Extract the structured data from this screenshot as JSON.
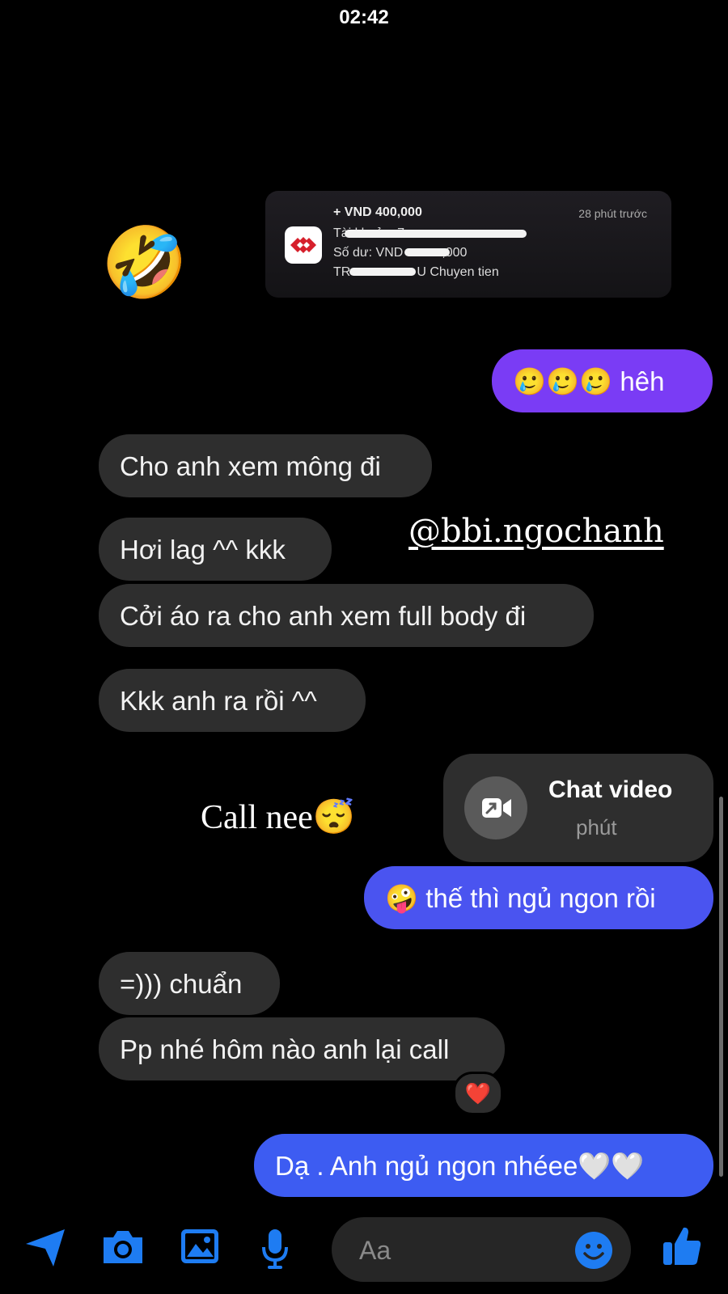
{
  "status_bar": {
    "time": "02:42"
  },
  "notification": {
    "amount": "+ VND 400,000",
    "time_ago": "28 phút trước",
    "account_label": "Tài khoản: ",
    "account_value_prefix": "7",
    "balance_label": "Số dư: VND",
    "balance_suffix": ",000",
    "content_prefix": "TR",
    "content_suffix": "U Chuyen tien"
  },
  "reaction_emoji": "🤣",
  "watermark": "@bbi.ngochanh",
  "overlay_caption": "Call nee😴",
  "messages": {
    "m1": "🥲🥲🥲 hêh",
    "m2": "Cho anh xem mông đi",
    "m3": "Hơi lag ^^ kkk",
    "m4": "Cởi áo ra cho anh xem full body đi",
    "m5": "Kkk anh ra rồi ^^",
    "m6": "🤪 thế thì ngủ ngon rồi",
    "m7": "=))) chuẩn",
    "m8": "Pp nhé hôm nào anh lại call",
    "m9": "Dạ . Anh ngủ ngon nhéee🤍🤍"
  },
  "video_call": {
    "title": "Chat video",
    "subtitle": "phút"
  },
  "message_reaction": "❤️",
  "composer": {
    "placeholder": "Aa"
  },
  "colors": {
    "incoming": "#2e2e2e",
    "outgoing_purple": "#7a3cf5",
    "outgoing_blue": "#3d5cf2",
    "icon_blue": "#1e7cf2"
  },
  "icons": [
    "send-location-icon",
    "camera-icon",
    "gallery-icon",
    "microphone-icon",
    "emoji-icon",
    "thumbs-up-icon",
    "video-call-icon",
    "bank-logo-icon"
  ]
}
